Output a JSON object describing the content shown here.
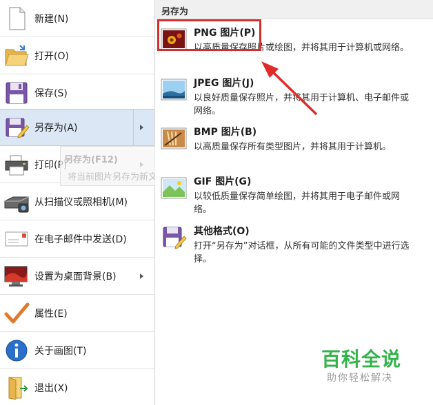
{
  "menu": {
    "items": [
      {
        "label": "新建(N)",
        "icon": "new-file-icon"
      },
      {
        "label": "打开(O)",
        "icon": "open-folder-icon"
      },
      {
        "label": "保存(S)",
        "icon": "save-disk-icon"
      },
      {
        "label": "另存为(A)",
        "icon": "save-as-icon",
        "selected": true,
        "has_submenu": true
      },
      {
        "label": "打印(P)",
        "icon": "printer-icon",
        "has_submenu": true
      },
      {
        "label": "从扫描仪或照相机(M)",
        "icon": "scanner-icon"
      },
      {
        "label": "在电子邮件中发送(D)",
        "icon": "email-icon"
      },
      {
        "label": "设置为桌面背景(B)",
        "icon": "desktop-background-icon",
        "has_submenu": true
      },
      {
        "label": "属性(E)",
        "icon": "checkmark-icon"
      },
      {
        "label": "关于画图(T)",
        "icon": "info-icon"
      },
      {
        "label": "退出(X)",
        "icon": "exit-icon"
      }
    ]
  },
  "tooltip": {
    "title": "另存为(F12)",
    "description": "将当前图片另存为新文件。"
  },
  "save_as_panel": {
    "header": "另存为",
    "formats": [
      {
        "title": "PNG 图片(P)",
        "description": "以高质量保存照片或绘图，并将其用于计算机或网络。",
        "icon": "png-image-icon",
        "highlighted": true
      },
      {
        "title": "JPEG 图片(J)",
        "description": "以良好质量保存照片，并将其用于计算机、电子邮件或网络。",
        "icon": "jpeg-image-icon"
      },
      {
        "title": "BMP 图片(B)",
        "description": "以高质量保存所有类型图片，并将其用于计算机。",
        "icon": "bmp-image-icon"
      },
      {
        "title": "GIF 图片(G)",
        "description": "以较低质量保存简单绘图，并将其用于电子邮件或网络。",
        "icon": "gif-image-icon"
      },
      {
        "title": "其他格式(O)",
        "description": "打开“另存为”对话框，从所有可能的文件类型中进行选择。",
        "icon": "other-formats-icon"
      }
    ]
  },
  "watermark": {
    "main": "百科全说",
    "sub": "助你轻松解决"
  },
  "colors": {
    "selected_bg": "#dbe7f5",
    "highlight_red": "#d32f2f",
    "watermark_green": "#32b34a"
  }
}
